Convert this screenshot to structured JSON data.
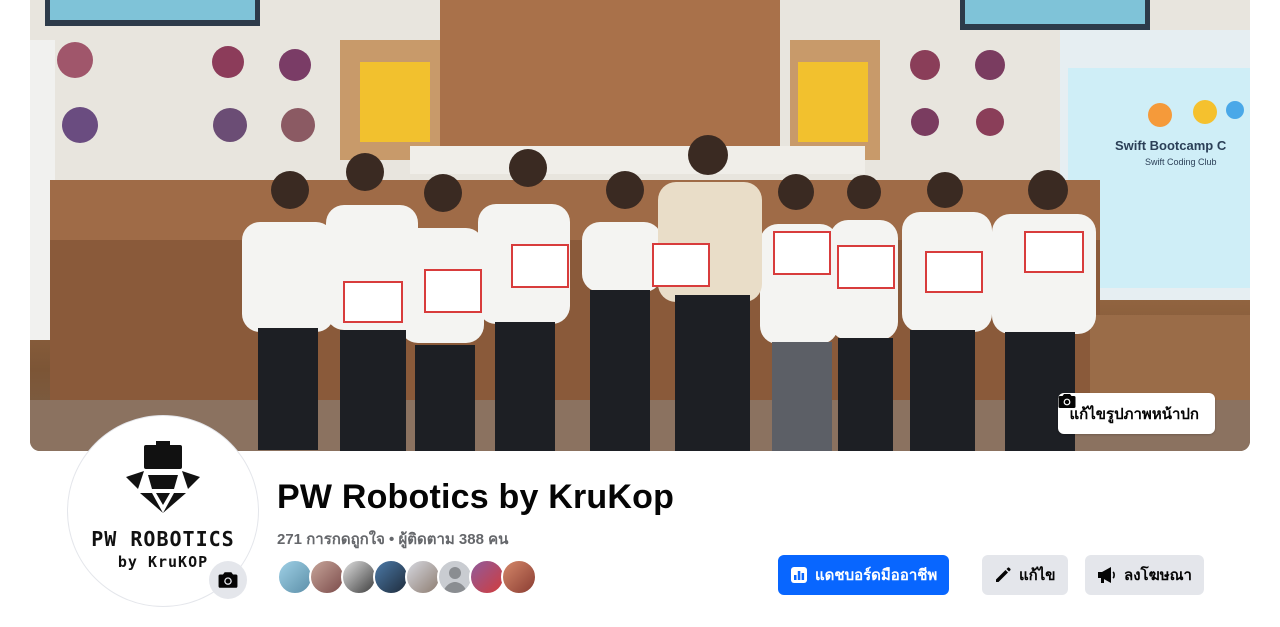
{
  "cover": {
    "edit_label": "แก้ไขรูปภาพหน้าปก",
    "screen_title": "Swift Bootcamp C",
    "screen_subtitle": "Swift Coding Club"
  },
  "profile": {
    "logo_title": "PW ROBOTICS",
    "logo_subtitle": "by KruKOP",
    "name": "PW Robotics by KruKop",
    "stats": "271 การกดถูกใจ • ผู้ติดตาม 388 คน"
  },
  "followers_count_shown": 8,
  "actions": {
    "dashboard_label": "แดชบอร์ดมืออาชีพ",
    "edit_label": "แก้ไข",
    "advertise_label": "ลงโฆษณา"
  },
  "colors": {
    "primary": "#0866ff",
    "secondary": "#e4e6eb",
    "text": "#050505",
    "muted": "#65676b"
  },
  "icons": [
    "camera-icon",
    "dashboard-icon",
    "pencil-icon",
    "megaphone-icon",
    "camera-icon"
  ]
}
